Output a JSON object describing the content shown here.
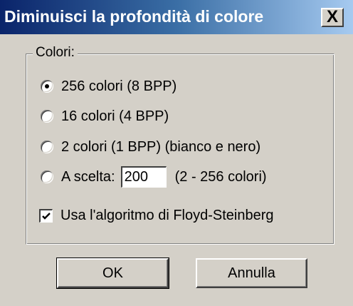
{
  "window": {
    "title": "Diminuisci la profondità di colore",
    "close_label": "X"
  },
  "colors_group": {
    "label": "Colori:",
    "options": [
      {
        "label": "256 colori  (8 BPP)",
        "selected": true
      },
      {
        "label": "16 colori  (4 BPP)",
        "selected": false
      },
      {
        "label": "2 colori  (1 BPP)  (bianco e nero)",
        "selected": false
      },
      {
        "label": "A scelta:",
        "selected": false
      }
    ],
    "custom": {
      "value": "200",
      "range_label": "(2 - 256 colori)"
    }
  },
  "floyd_steinberg": {
    "label": "Usa l'algoritmo di Floyd-Steinberg",
    "checked": true
  },
  "buttons": {
    "ok": "OK",
    "cancel": "Annulla"
  }
}
